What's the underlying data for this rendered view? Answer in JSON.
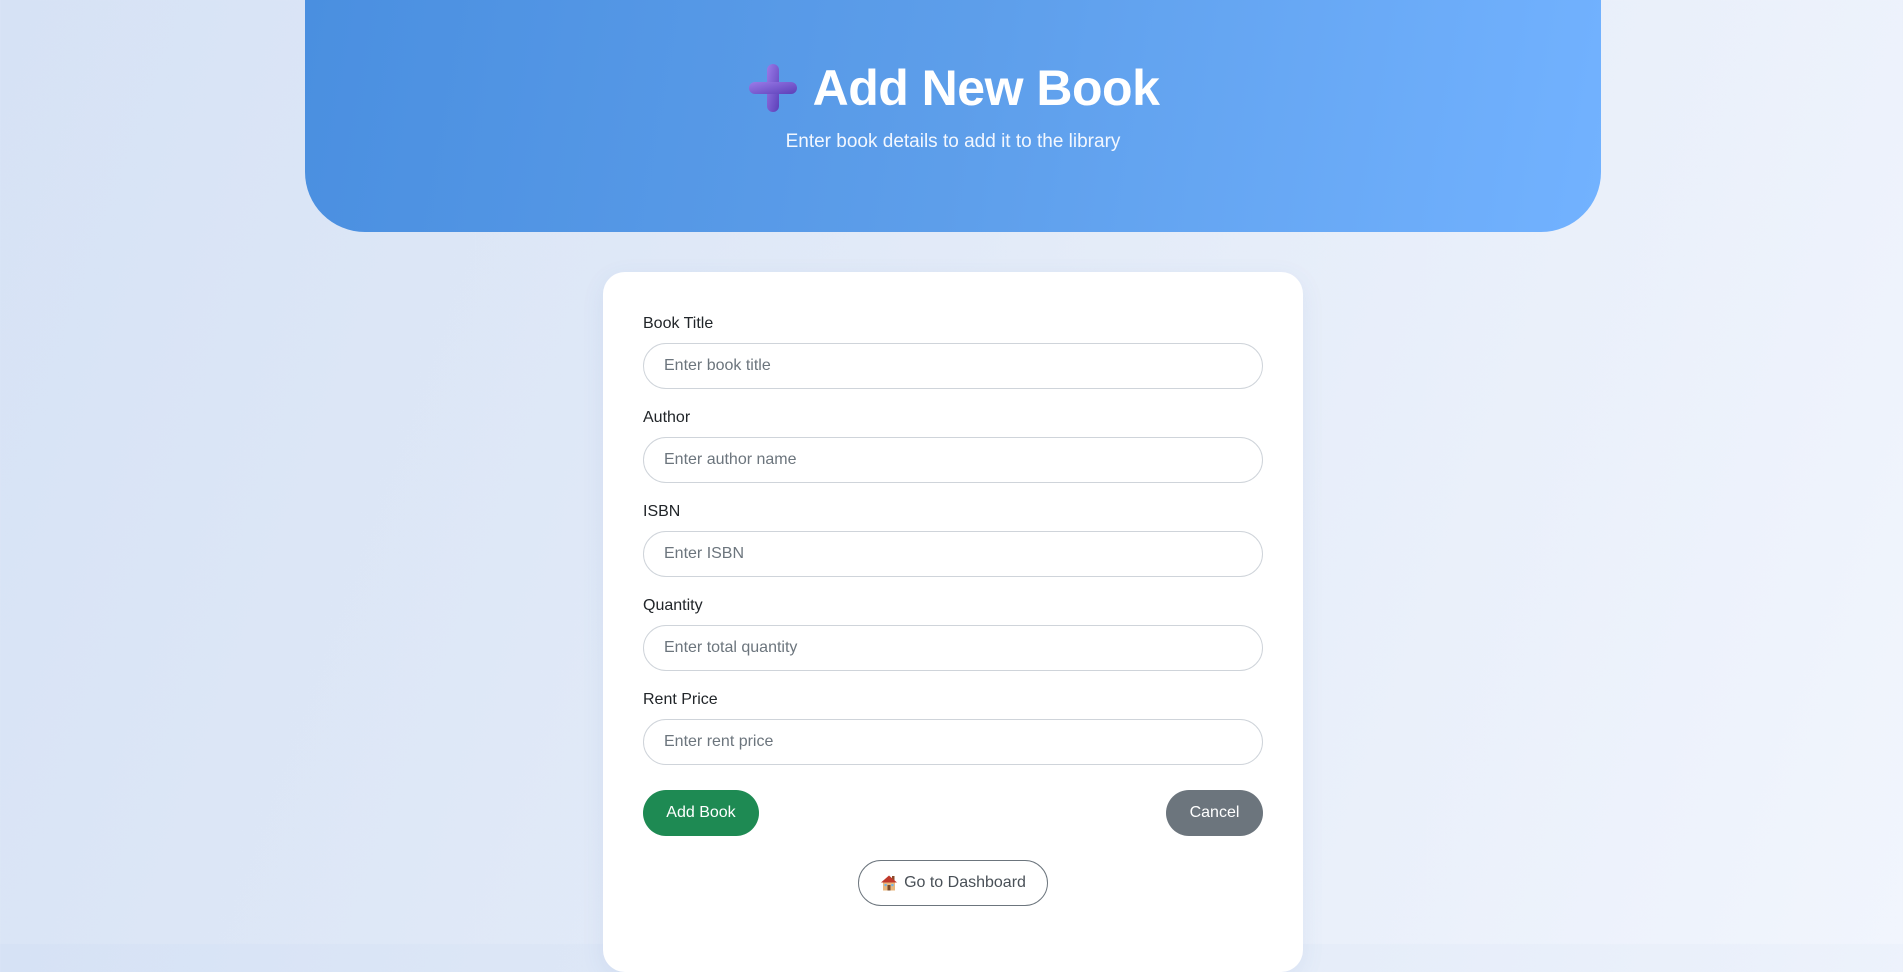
{
  "header": {
    "icon": "plus-icon",
    "title": "Add New Book",
    "subtitle": "Enter book details to add it to the library"
  },
  "form": {
    "fields": [
      {
        "label": "Book Title",
        "placeholder": "Enter book title",
        "value": ""
      },
      {
        "label": "Author",
        "placeholder": "Enter author name",
        "value": ""
      },
      {
        "label": "ISBN",
        "placeholder": "Enter ISBN",
        "value": ""
      },
      {
        "label": "Quantity",
        "placeholder": "Enter total quantity",
        "value": ""
      },
      {
        "label": "Rent Price",
        "placeholder": "Enter rent price",
        "value": ""
      }
    ],
    "add_label": "Add Book",
    "cancel_label": "Cancel",
    "dashboard_label": "Go to Dashboard",
    "dashboard_icon": "house-icon"
  },
  "colors": {
    "header_gradient_start": "#4a8fe0",
    "header_gradient_end": "#72b2ff",
    "add_button": "#1e8a53",
    "cancel_button": "#6c757d"
  }
}
